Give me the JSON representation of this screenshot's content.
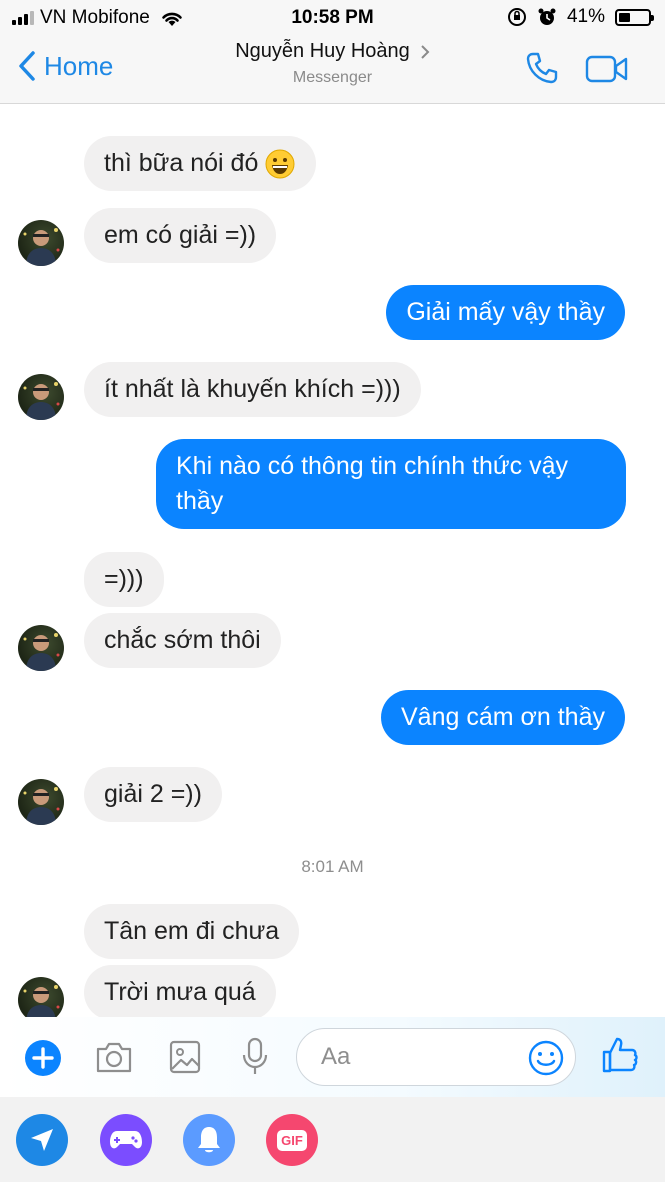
{
  "status_bar": {
    "carrier": "VN Mobifone",
    "time": "10:58 PM",
    "battery": "41%",
    "battery_level": 0.41
  },
  "header": {
    "back_label": "Home",
    "contact_name": "Nguyễn Huy Hoàng",
    "subtitle": "Messenger"
  },
  "messages": [
    {
      "from": "them",
      "text": "thì bữa nói đó",
      "emoji": "grinning-face-icon"
    },
    {
      "from": "them",
      "text": "em có giải =))"
    },
    {
      "from": "me",
      "text": "Giải mấy vậy thầy"
    },
    {
      "from": "them",
      "text": "ít nhất là khuyến khích =)))"
    },
    {
      "from": "me",
      "text": "Khi nào có thông tin chính thức vậy thầy"
    },
    {
      "from": "them",
      "text": "=)))"
    },
    {
      "from": "them",
      "text": "chắc sớm thôi"
    },
    {
      "from": "me",
      "text": "Vâng cám ơn thầy"
    },
    {
      "from": "them",
      "text": "giải 2 =))"
    },
    {
      "from": "them",
      "text": "Tân em đi chưa"
    },
    {
      "from": "them",
      "text": "Trời mưa quá"
    }
  ],
  "timestamp": "8:01 AM",
  "composer": {
    "placeholder": "Aa"
  },
  "apps": {
    "gif_label": "GIF"
  },
  "colors": {
    "accent": "#0b84ff",
    "link": "#1e88e5",
    "incoming_bubble": "#f1f0f0",
    "games": "#7b4dff",
    "notification": "#5b9bff",
    "gif": "#f5476f"
  }
}
